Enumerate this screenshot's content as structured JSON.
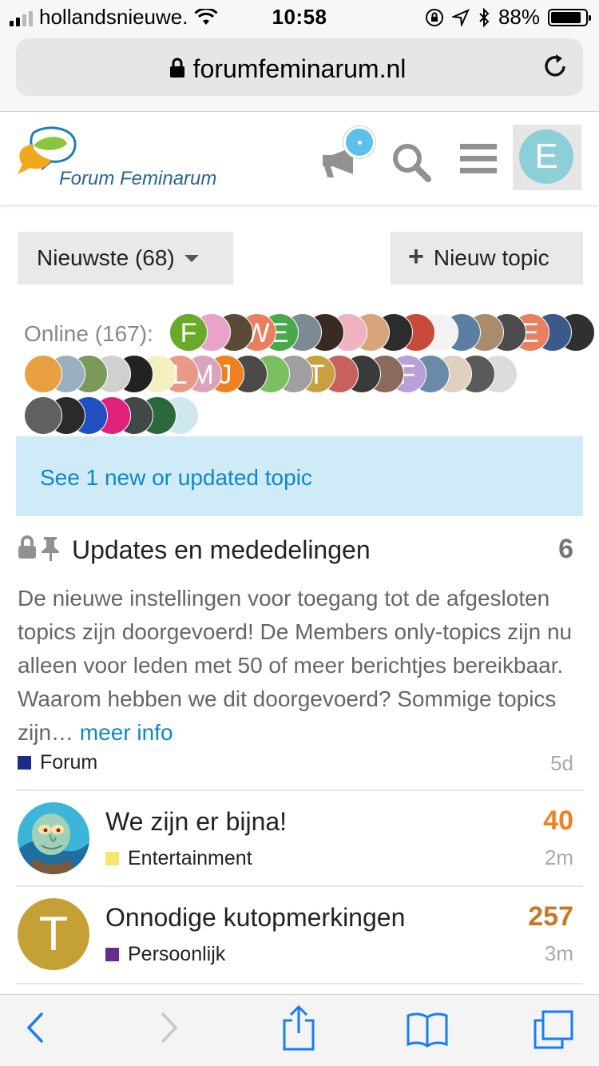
{
  "status": {
    "carrier": "hollandsnieuwe.",
    "time": "10:58",
    "battery": "88%",
    "battery_level": 0.88
  },
  "browser": {
    "domain": "forumfeminarum.nl"
  },
  "header": {
    "logo_text": "Forum Feminarum",
    "user_initial": "E",
    "user_color": "#8ccfd6"
  },
  "controls": {
    "latest_label": "Nieuwste (68)",
    "new_topic_label": "Nieuw topic"
  },
  "online": {
    "label": "Online (167):",
    "avatars": [
      {
        "i": "F",
        "c": "#6aaa2a"
      },
      {
        "i": "",
        "c": "#e7a4c8"
      },
      {
        "i": "",
        "c": "#5a4a38"
      },
      {
        "i": "W",
        "c": "#e8805f"
      },
      {
        "i": "E",
        "c": "#4aa84a"
      },
      {
        "i": "",
        "c": "#7c8a94"
      },
      {
        "i": "",
        "c": "#3b2a22"
      },
      {
        "i": "",
        "c": "#f0b2c0"
      },
      {
        "i": "",
        "c": "#d8a57a"
      },
      {
        "i": "",
        "c": "#2c2c2c"
      },
      {
        "i": "",
        "c": "#c84a3a"
      },
      {
        "i": "",
        "c": "#f2f2f2"
      },
      {
        "i": "",
        "c": "#5a7fa0"
      },
      {
        "i": "",
        "c": "#a88c6c"
      },
      {
        "i": "",
        "c": "#4c4c4c"
      },
      {
        "i": "E",
        "c": "#e8805f"
      },
      {
        "i": "",
        "c": "#3a5a8a"
      },
      {
        "i": "",
        "c": "#303030"
      },
      {
        "i": "",
        "c": "#e9a040"
      },
      {
        "i": "",
        "c": "#9ab0c0"
      },
      {
        "i": "",
        "c": "#7a9a5a"
      },
      {
        "i": "",
        "c": "#d0d0d0"
      },
      {
        "i": "",
        "c": "#222222"
      },
      {
        "i": "",
        "c": "#f4f0c0"
      },
      {
        "i": "L",
        "c": "#e89a86"
      },
      {
        "i": "M",
        "c": "#d9a3bb"
      },
      {
        "i": "J",
        "c": "#f08020"
      },
      {
        "i": "",
        "c": "#4a4a4a"
      },
      {
        "i": "",
        "c": "#7ac060"
      },
      {
        "i": "",
        "c": "#a0a0a0"
      },
      {
        "i": "T",
        "c": "#c8a040"
      },
      {
        "i": "",
        "c": "#c86060"
      },
      {
        "i": "",
        "c": "#3a3a3a"
      },
      {
        "i": "",
        "c": "#8a6a5a"
      },
      {
        "i": "F",
        "c": "#b8a0d8"
      },
      {
        "i": "",
        "c": "#6a8aa8"
      },
      {
        "i": "",
        "c": "#e0d0c0"
      },
      {
        "i": "",
        "c": "#5a5a5a"
      },
      {
        "i": "",
        "c": "#dcdcdc"
      },
      {
        "i": "",
        "c": "#606060"
      },
      {
        "i": "",
        "c": "#2a2a2a"
      },
      {
        "i": "",
        "c": "#2050c0"
      },
      {
        "i": "",
        "c": "#e0207a"
      },
      {
        "i": "",
        "c": "#404848"
      },
      {
        "i": "",
        "c": "#2a6a3a"
      },
      {
        "i": "",
        "c": "#cfe8f0"
      }
    ]
  },
  "banner": {
    "text": "See 1 new or updated topic"
  },
  "topics": [
    {
      "title": "Updates en mededelingen",
      "count": "6",
      "count_color": "#777777",
      "excerpt": "De nieuwe instellingen voor toegang tot de afgesloten topics zijn doorgevoerd! De Members only-topics zijn nu alleen voor leden met 50 of meer berichtjes bereikbaar. Waarom hebben we dit doorgevoerd? Sommige topics zijn…",
      "more": "meer info",
      "category": "Forum",
      "category_color": "#1c2a8a",
      "age": "5d"
    },
    {
      "title": "We zijn er bijna!",
      "count": "40",
      "count_color": "#f08020",
      "category": "Entertainment",
      "category_color": "#f7e46a",
      "age": "2m"
    },
    {
      "title": "Onnodige kutopmerkingen",
      "count": "257",
      "count_color": "#c8782a",
      "category": "Persoonlijk",
      "category_color": "#652d90",
      "age": "3m",
      "avatar_initial": "T",
      "avatar_color": "#c5a035"
    }
  ]
}
